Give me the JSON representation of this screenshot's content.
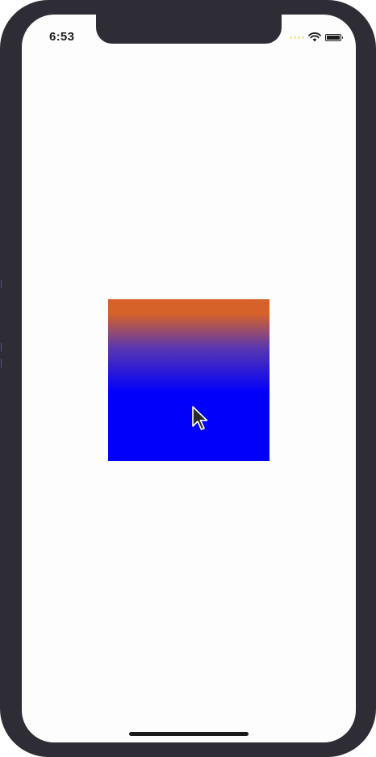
{
  "status_bar": {
    "time": "6:53",
    "wifi_icon": "wifi-icon",
    "battery_icon": "battery-icon",
    "battery_level": 1.0
  },
  "content": {
    "gradient_view": {
      "colors": [
        "#d6622a",
        "#5b37b0",
        "#0000fb"
      ],
      "direction": "top-to-bottom"
    },
    "pointer_icon": "cursor-arrow-icon"
  },
  "home_indicator": "home-indicator"
}
